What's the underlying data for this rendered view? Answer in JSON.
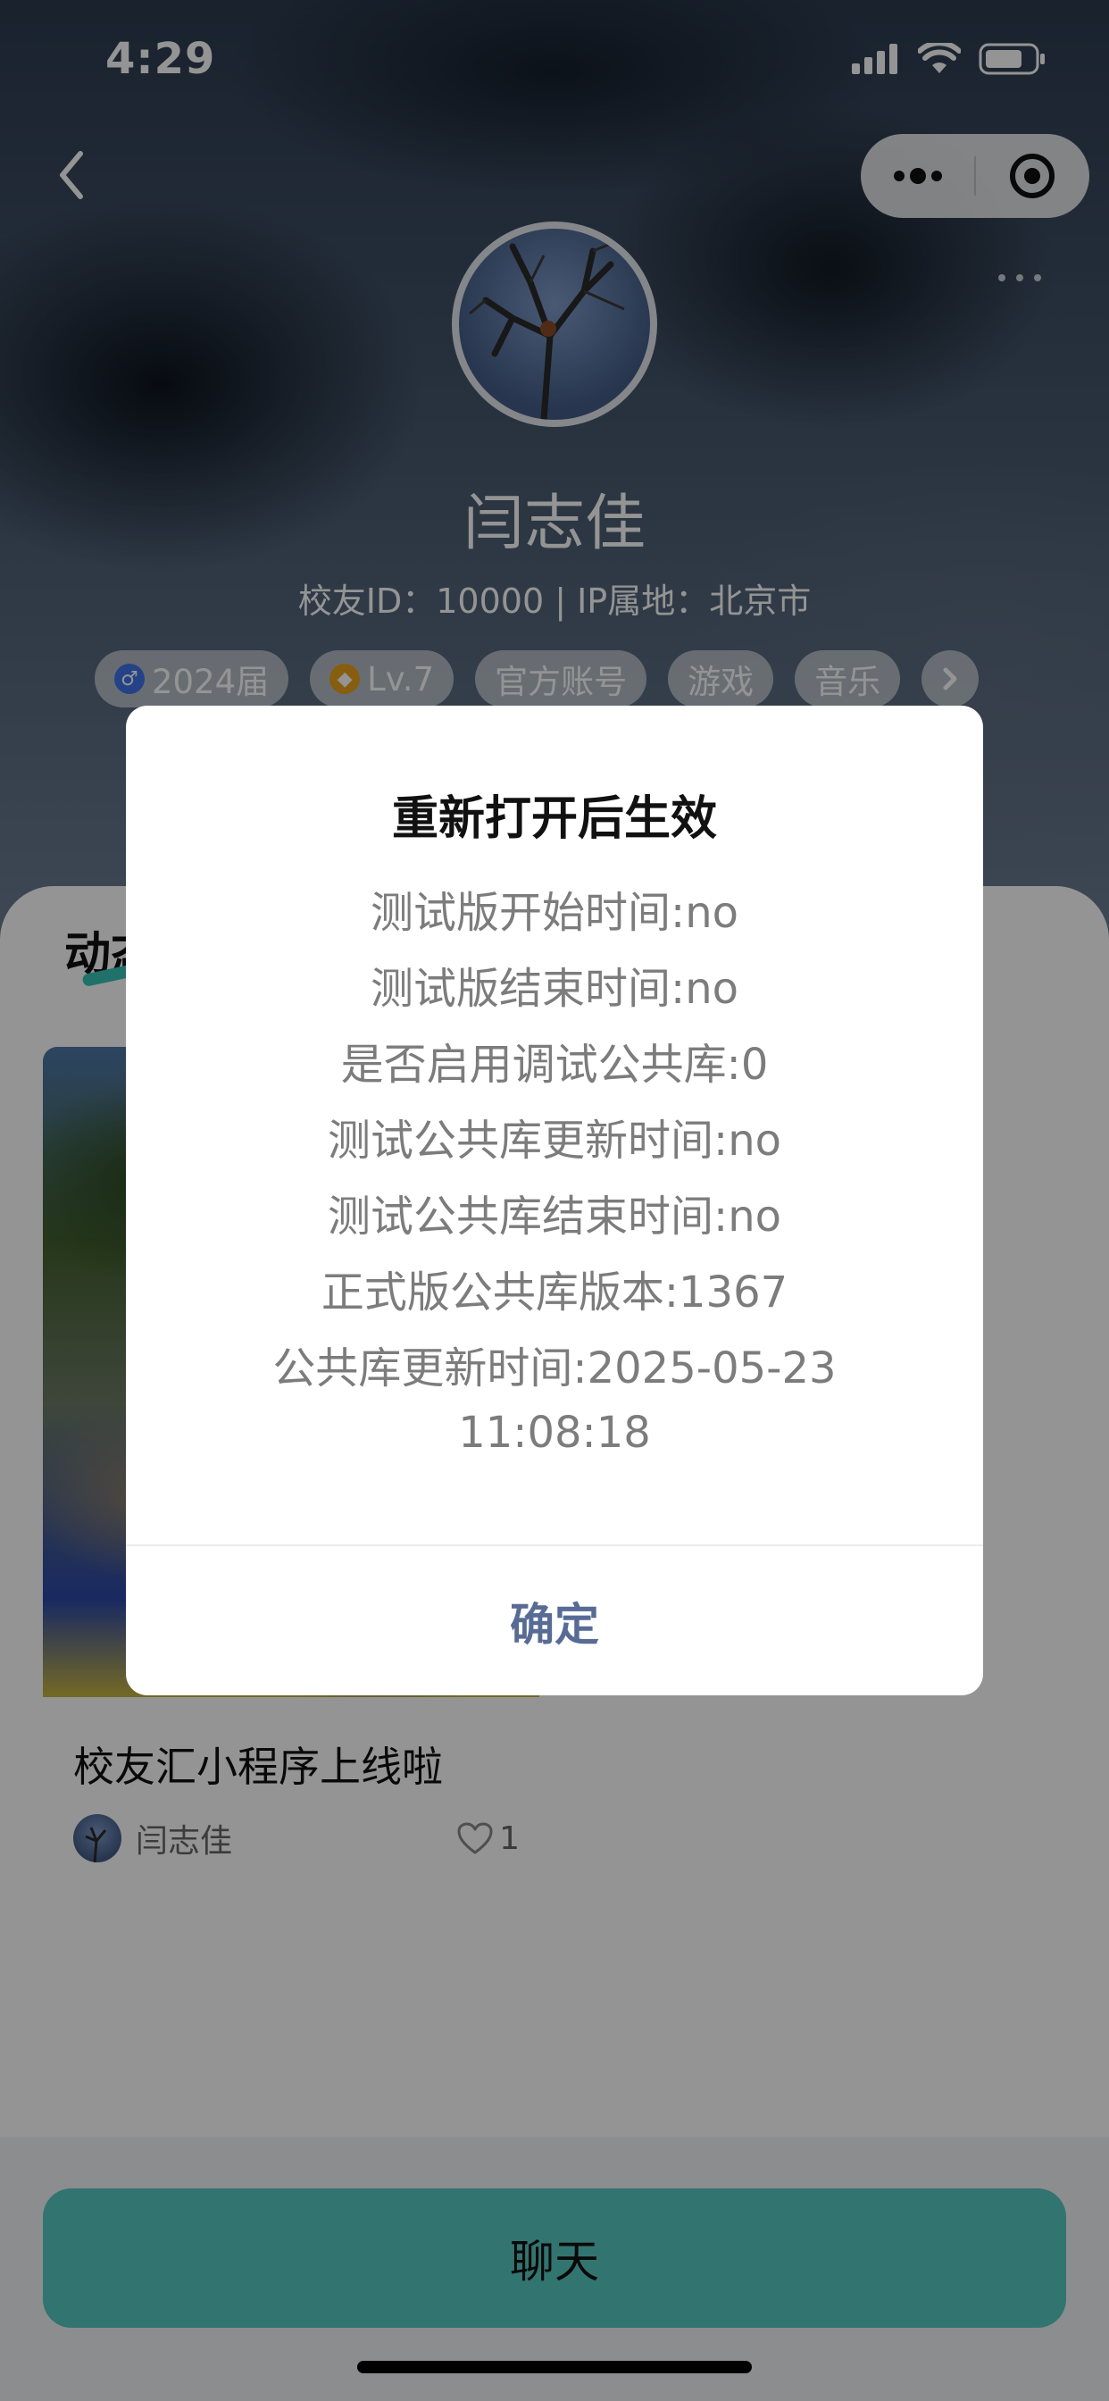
{
  "status_bar": {
    "time": "4:29"
  },
  "profile": {
    "name": "闫志佳",
    "meta": "校友ID：10000 | IP属地：北京市",
    "tags": [
      "2024届",
      "Lv.7",
      "官方账号",
      "游戏",
      "音乐"
    ]
  },
  "feed": {
    "tab_label": "动态",
    "post": {
      "title": "校友汇小程序上线啦",
      "author": "闫志佳",
      "likes": "1"
    }
  },
  "chat_button": {
    "label": "聊天"
  },
  "dialog": {
    "title": "重新打开后生效",
    "lines": [
      "测试版开始时间:no",
      "测试版结束时间:no",
      "是否启用调试公共库:0",
      "测试公共库更新时间:no",
      "测试公共库结束时间:no",
      "正式版公共库版本:1367",
      "公共库更新时间:2025-05-23 11:08:18"
    ],
    "confirm_label": "确定"
  },
  "colors": {
    "accent": "#56c8c2",
    "dialog_link": "#576b95",
    "gender_badge": "#3f73e8",
    "level_badge": "#e9a11c"
  },
  "icons": [
    "signal-icon",
    "wifi-icon",
    "battery-icon",
    "back-arrow-icon",
    "capsule-more-icon",
    "capsule-close-icon",
    "more-dots-icon",
    "male-icon",
    "diamond-icon",
    "chevron-right-icon",
    "heart-icon"
  ]
}
